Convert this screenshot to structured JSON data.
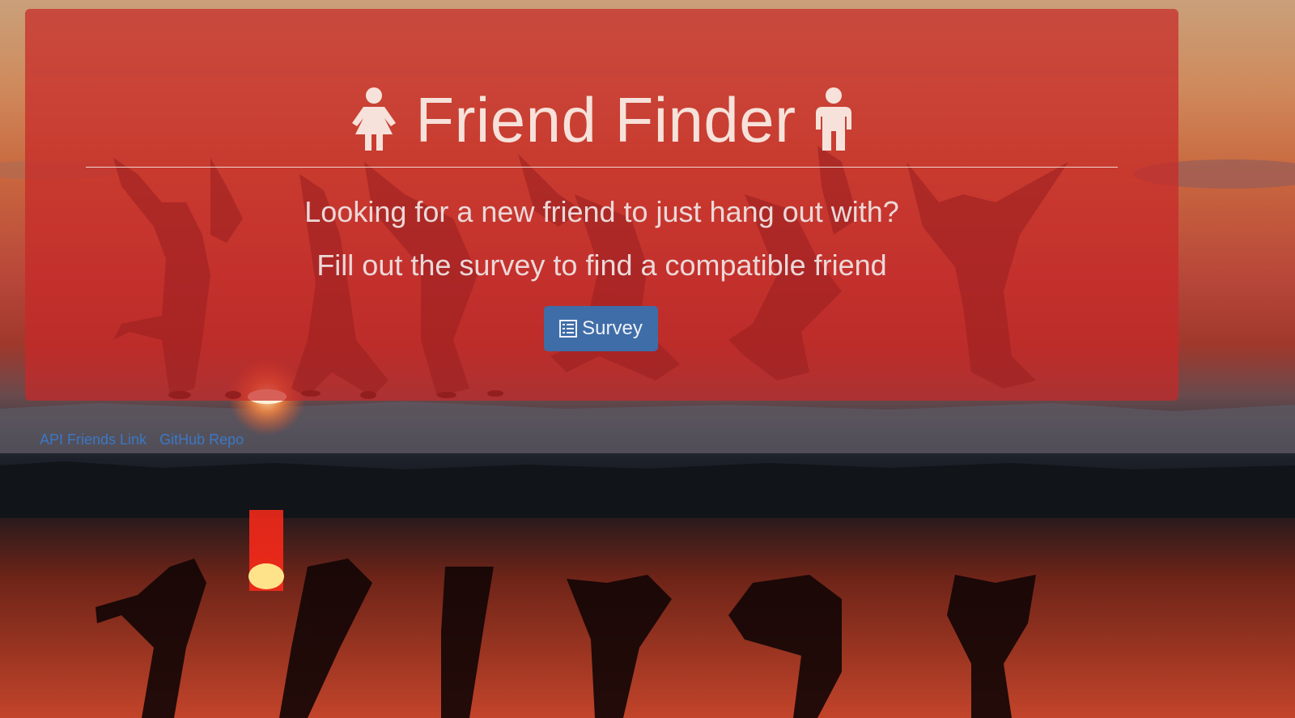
{
  "jumbotron": {
    "title": "Friend Finder",
    "line1": "Looking for a new friend to just hang out with?",
    "line2": "Fill out the survey to find a compatible friend",
    "survey_button": "Survey"
  },
  "footer": {
    "links": [
      "API Friends Link",
      "GitHub Repo"
    ]
  },
  "icons": {
    "left": "female-person-icon",
    "right": "male-person-icon",
    "button": "list-icon"
  },
  "colors": {
    "panel": "#c82828",
    "button": "#3f6da8",
    "link": "#3b78c4",
    "title_text": "#f6e2da"
  }
}
